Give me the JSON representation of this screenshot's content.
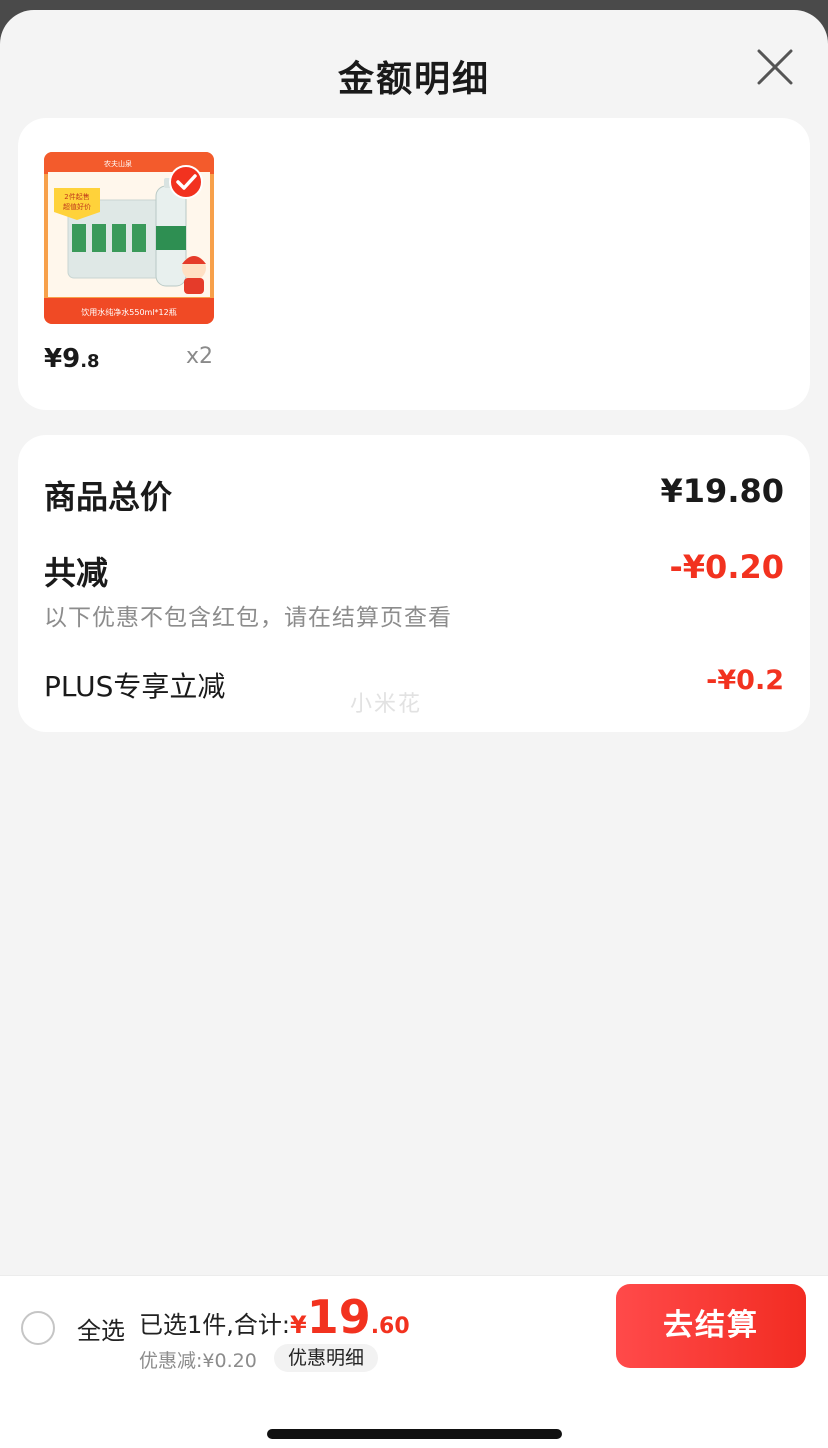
{
  "sheet": {
    "title": "金额明细"
  },
  "product": {
    "price_int": "¥9",
    "price_dec": ".8",
    "quantity": "x2",
    "image_badge_top": "农夫山泉",
    "image_promo": "2件起售\n超值好价",
    "image_caption": "饮用水纯净水550ml*12瓶",
    "selected": true
  },
  "summary": {
    "total_label": "商品总价",
    "total_value": "¥19.80",
    "reduce_label": "共减",
    "reduce_value": "-¥0.20",
    "note": "以下优惠不包含红包，请在结算页查看",
    "plus_label": "PLUS专享立减",
    "plus_value": "-¥0.2"
  },
  "watermark": "小米花",
  "bottom": {
    "select_all": "全选",
    "selected_text": "已选1件,合计:",
    "total_yen": "¥",
    "total_int": "19",
    "total_dec": ".60",
    "discount": "优惠减:¥0.20",
    "detail_button": "优惠明细",
    "checkout_button": "去结算"
  },
  "colors": {
    "accent": "#f2321f",
    "checkout_bg": "#f22c22",
    "background": "#f4f4f4"
  }
}
